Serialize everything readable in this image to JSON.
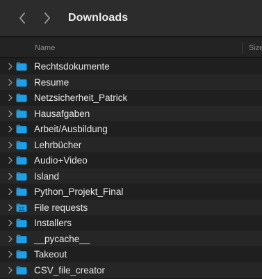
{
  "window": {
    "title": "Downloads",
    "nav": {
      "back_icon": "chevron-left-icon",
      "forward_icon": "chevron-right-icon"
    }
  },
  "columns": {
    "name": "Name",
    "size": "Size"
  },
  "colors": {
    "folder_blue": "#1fa0e6",
    "folder_tab": "#1587c8",
    "background": "#1f1f1f",
    "text": "#e9e9e9"
  },
  "items": [
    {
      "label": "Rechtsdokumente",
      "icon": "folder-icon"
    },
    {
      "label": "Resume",
      "icon": "folder-icon"
    },
    {
      "label": "Netzsicherheit_Patrick",
      "icon": "folder-icon"
    },
    {
      "label": "Hausafgaben",
      "icon": "folder-icon"
    },
    {
      "label": "Arbeit/Ausbildung",
      "icon": "folder-icon"
    },
    {
      "label": "Lehrbücher",
      "icon": "folder-icon"
    },
    {
      "label": "Audio+Video",
      "icon": "folder-icon"
    },
    {
      "label": "Island",
      "icon": "folder-icon"
    },
    {
      "label": "Python_Projekt_Final",
      "icon": "folder-icon"
    },
    {
      "label": "File requests",
      "icon": "shared-folder-icon"
    },
    {
      "label": "Installers",
      "icon": "folder-icon"
    },
    {
      "label": "__pycache__",
      "icon": "folder-icon"
    },
    {
      "label": "Takeout",
      "icon": "folder-icon"
    },
    {
      "label": "CSV_file_creator",
      "icon": "folder-icon"
    }
  ]
}
